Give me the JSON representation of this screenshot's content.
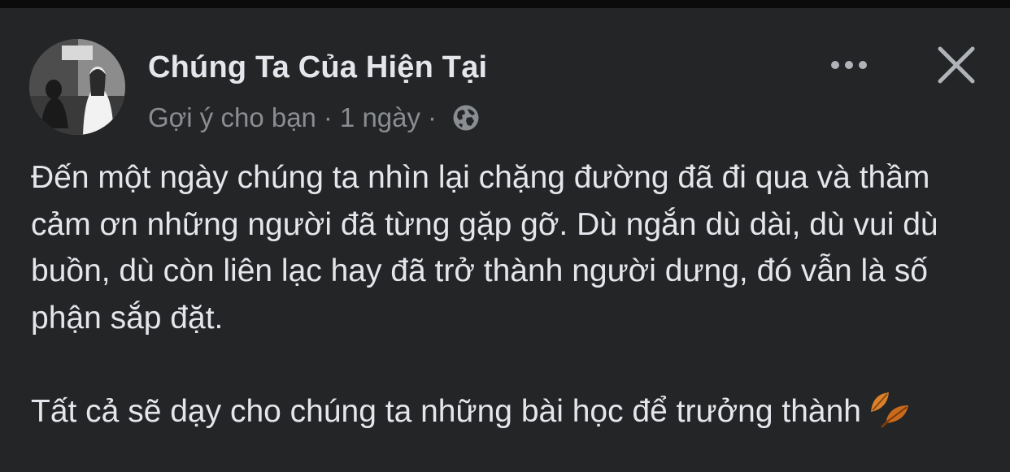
{
  "post": {
    "author_name": "Chúng Ta Của Hiện Tại",
    "meta": {
      "label": "Gợi ý cho bạn",
      "separator": "·",
      "time": "1 ngày",
      "audience_icon": "globe-icon"
    },
    "body": {
      "paragraph_1": "Đến một ngày chúng ta nhìn lại chặng đường đã đi qua và thầm cảm ơn những người đã từng gặp gỡ. Dù ngắn dù dài, dù vui dù buồn, dù còn liên lạc hay đã trở thành người dưng, đó vẫn là số phận sắp đặt.",
      "paragraph_2": "Tất cả sẽ dạy cho chúng ta những bài học để trưởng thành",
      "emoji": "fallen-leaf-icon"
    }
  },
  "actions": {
    "more_icon": "more-horizontal-icon",
    "close_icon": "close-icon"
  },
  "colors": {
    "card_background": "#242526",
    "primary_text": "#e4e6eb",
    "secondary_text": "#8a8d91",
    "icon": "#b0b3b8"
  }
}
